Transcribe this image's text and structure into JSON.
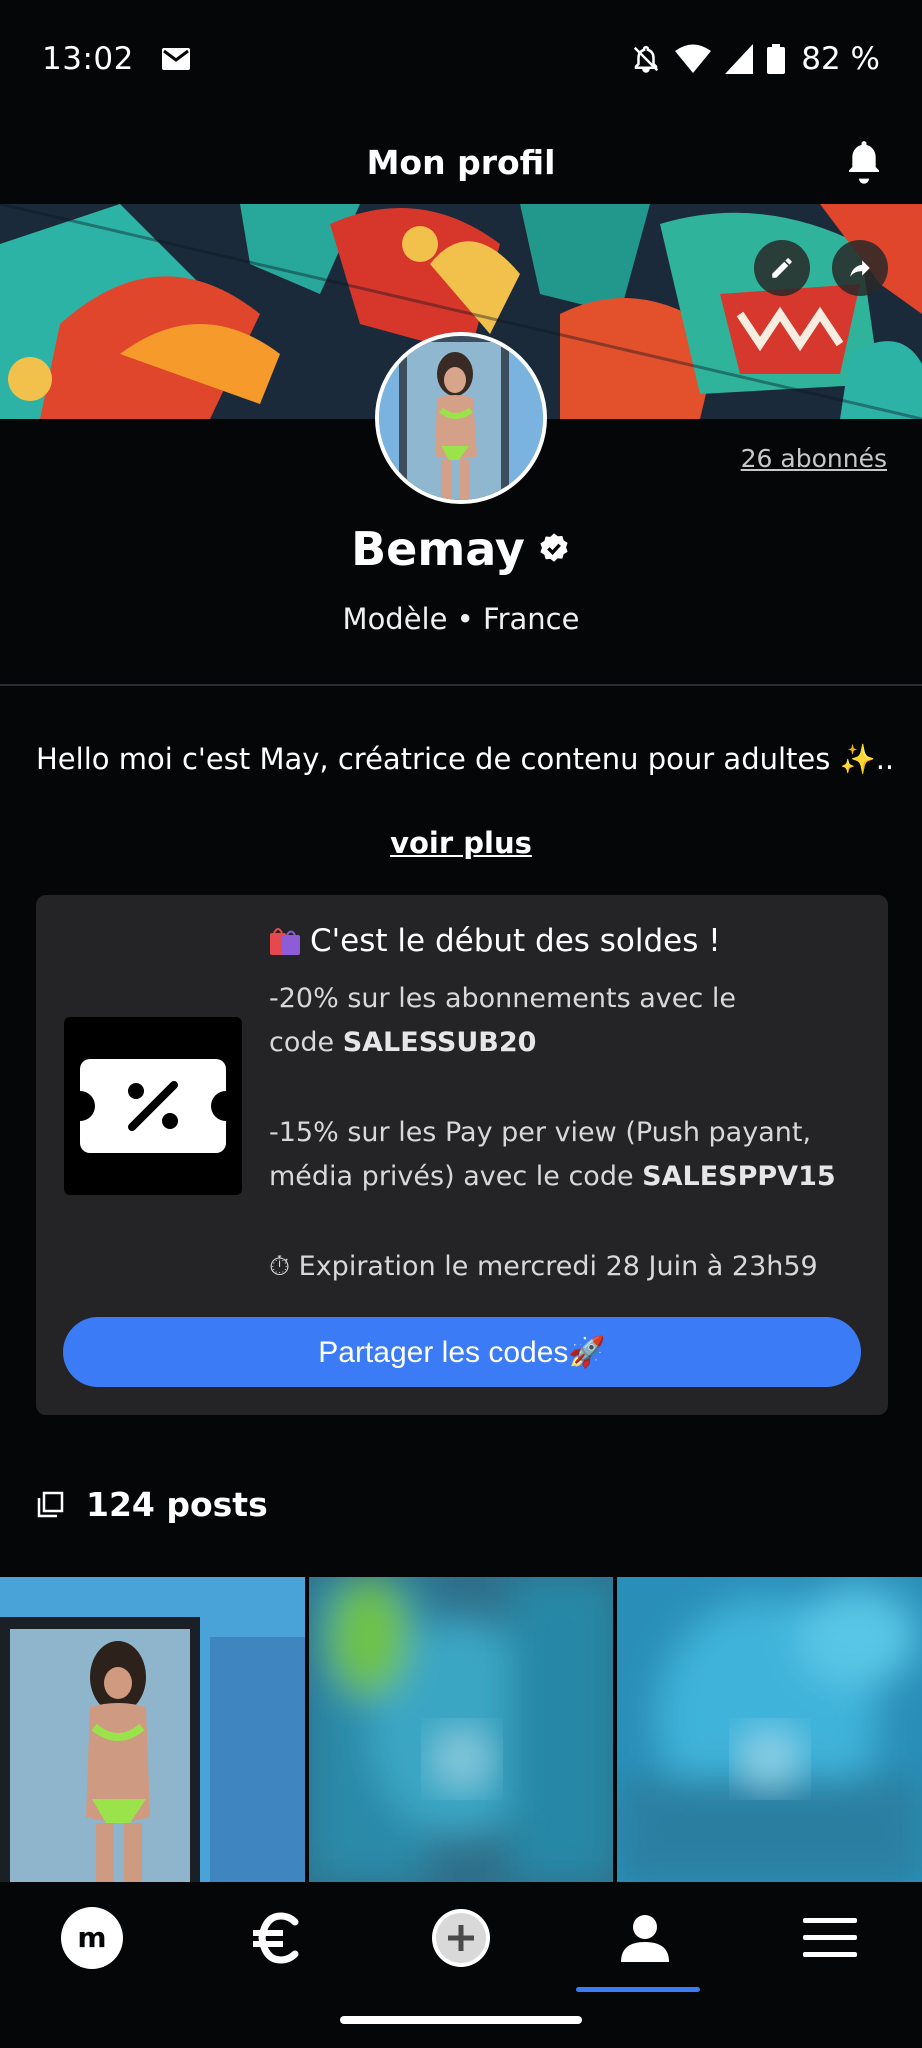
{
  "status_bar": {
    "time": "13:02",
    "battery": "82 %",
    "icons": [
      "mail-icon",
      "mute-icon",
      "wifi-icon",
      "signal-icon",
      "battery-icon"
    ]
  },
  "header": {
    "title": "Mon profil",
    "icons": [
      "bell-icon"
    ]
  },
  "banner": {
    "actions": [
      "edit-icon",
      "share-icon"
    ]
  },
  "profile": {
    "subscribers": "26 abonnés",
    "name": "Bemay",
    "subtitle": "Modèle • France",
    "bio": "Hello moi c'est May, créatrice de contenu pour adultes ✨...",
    "see_more": "voir plus"
  },
  "promo": {
    "title": "C'est le début des soldes !",
    "line1": "-20% sur les abonnements avec le",
    "line2_prefix": "code ",
    "code1": "SALESSUB20",
    "line3": "-15% sur les Pay per view (Push payant,",
    "line4_prefix": "média privés) avec le code ",
    "code2": "SALESPPV15",
    "expiration": "⏱ Expiration le mercredi 28 Juin à 23h59",
    "button": "Partager les codes🚀"
  },
  "posts": {
    "count": "124 posts"
  },
  "nav": {
    "logo_letter": "m",
    "items": [
      "home-logo-icon",
      "euro-icon",
      "add-icon",
      "profile-icon",
      "menu-icon"
    ],
    "active_index": 3,
    "accent": "#3b7bf6"
  }
}
